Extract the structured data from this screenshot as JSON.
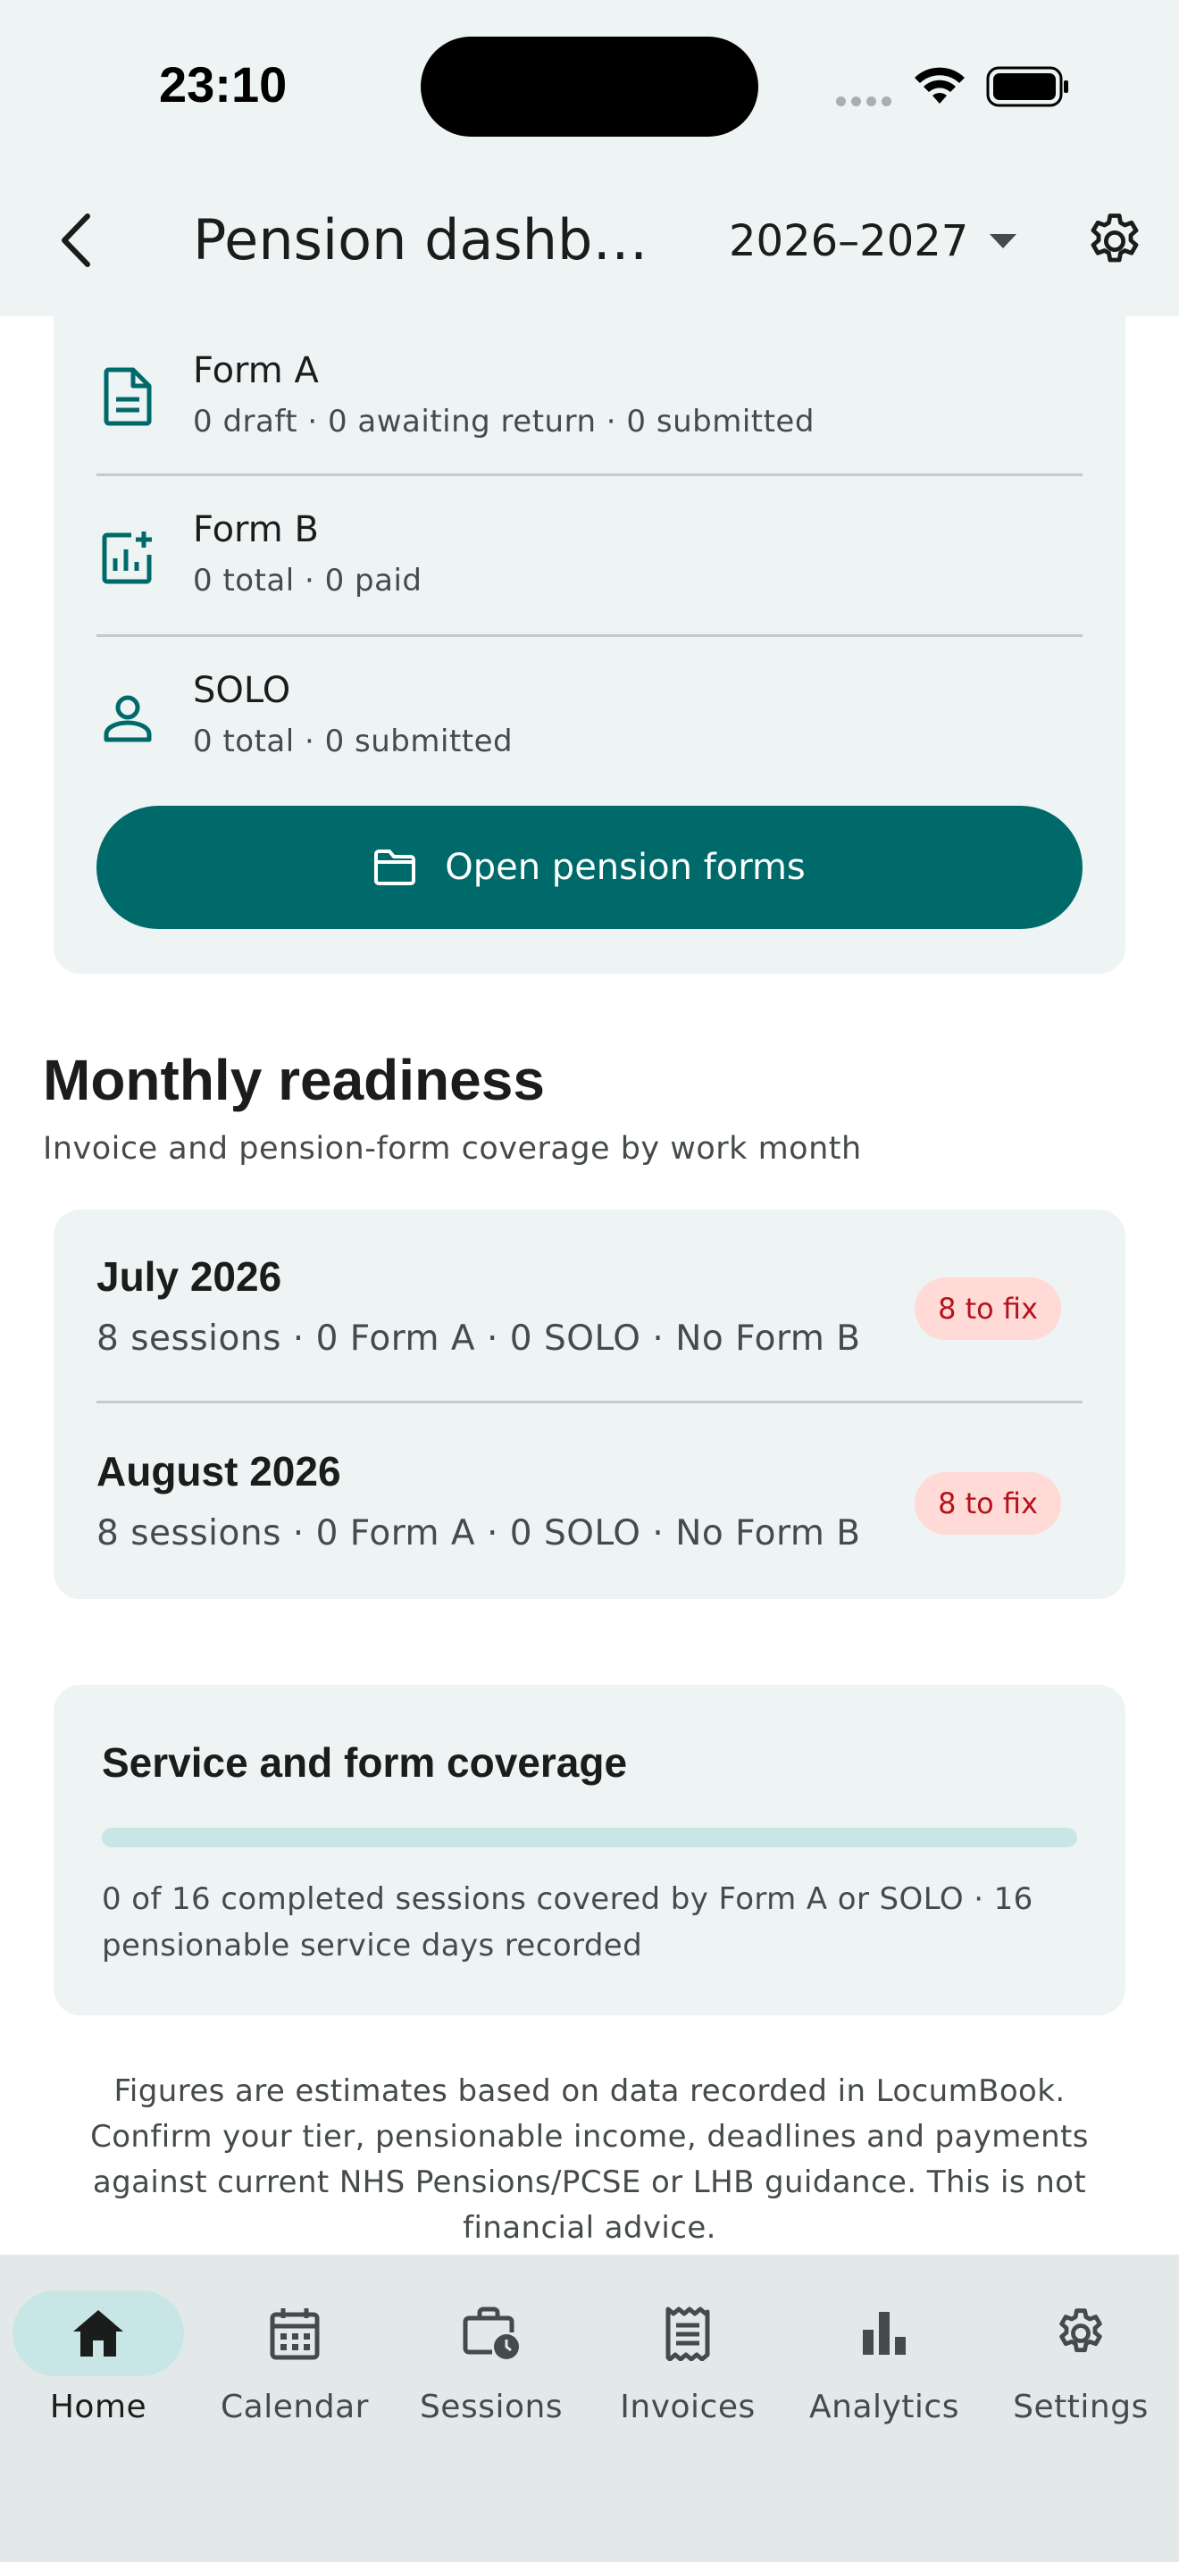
{
  "status_bar": {
    "time": "23:10"
  },
  "header": {
    "title": "Pension dashbo…",
    "year": "2026–2027"
  },
  "forms": [
    {
      "title": "Form A",
      "summary": "0 draft · 0 awaiting return · 0 submitted",
      "icon": "document-icon"
    },
    {
      "title": "Form B",
      "summary": "0 total · 0 paid",
      "icon": "chart-add-icon"
    },
    {
      "title": "SOLO",
      "summary": "0 total · 0 submitted",
      "icon": "person-icon"
    }
  ],
  "open_forms_button": "Open pension forms",
  "monthly": {
    "title": "Monthly readiness",
    "subtitle": "Invoice and pension-form coverage by work month",
    "months": [
      {
        "month": "July 2026",
        "summary": "8 sessions · 0 Form A · 0 SOLO · No Form B",
        "badge": "8 to fix"
      },
      {
        "month": "August 2026",
        "summary": "8 sessions · 0 Form A · 0 SOLO · No Form B",
        "badge": "8 to fix"
      }
    ]
  },
  "coverage": {
    "title": "Service and form coverage",
    "progress": 0,
    "text": "0 of 16 completed sessions covered by Form A or SOLO · 16 pensionable service days recorded"
  },
  "disclaimer": "Figures are estimates based on data recorded in LocumBook. Confirm your tier, pensionable income, deadlines and payments against current NHS Pensions/PCSE or LHB guidance. This is not financial advice.",
  "nav": [
    {
      "label": "Home",
      "icon": "home-icon",
      "active": true
    },
    {
      "label": "Calendar",
      "icon": "calendar-icon",
      "active": false
    },
    {
      "label": "Sessions",
      "icon": "briefcase-clock-icon",
      "active": false
    },
    {
      "label": "Invoices",
      "icon": "receipt-icon",
      "active": false
    },
    {
      "label": "Analytics",
      "icon": "bar-chart-icon",
      "active": false
    },
    {
      "label": "Settings",
      "icon": "gear-icon",
      "active": false
    }
  ],
  "colors": {
    "primary": "#006a6b",
    "surface": "#eef3f3",
    "badge_bg": "#ffdad7",
    "badge_text": "#b3131b"
  }
}
